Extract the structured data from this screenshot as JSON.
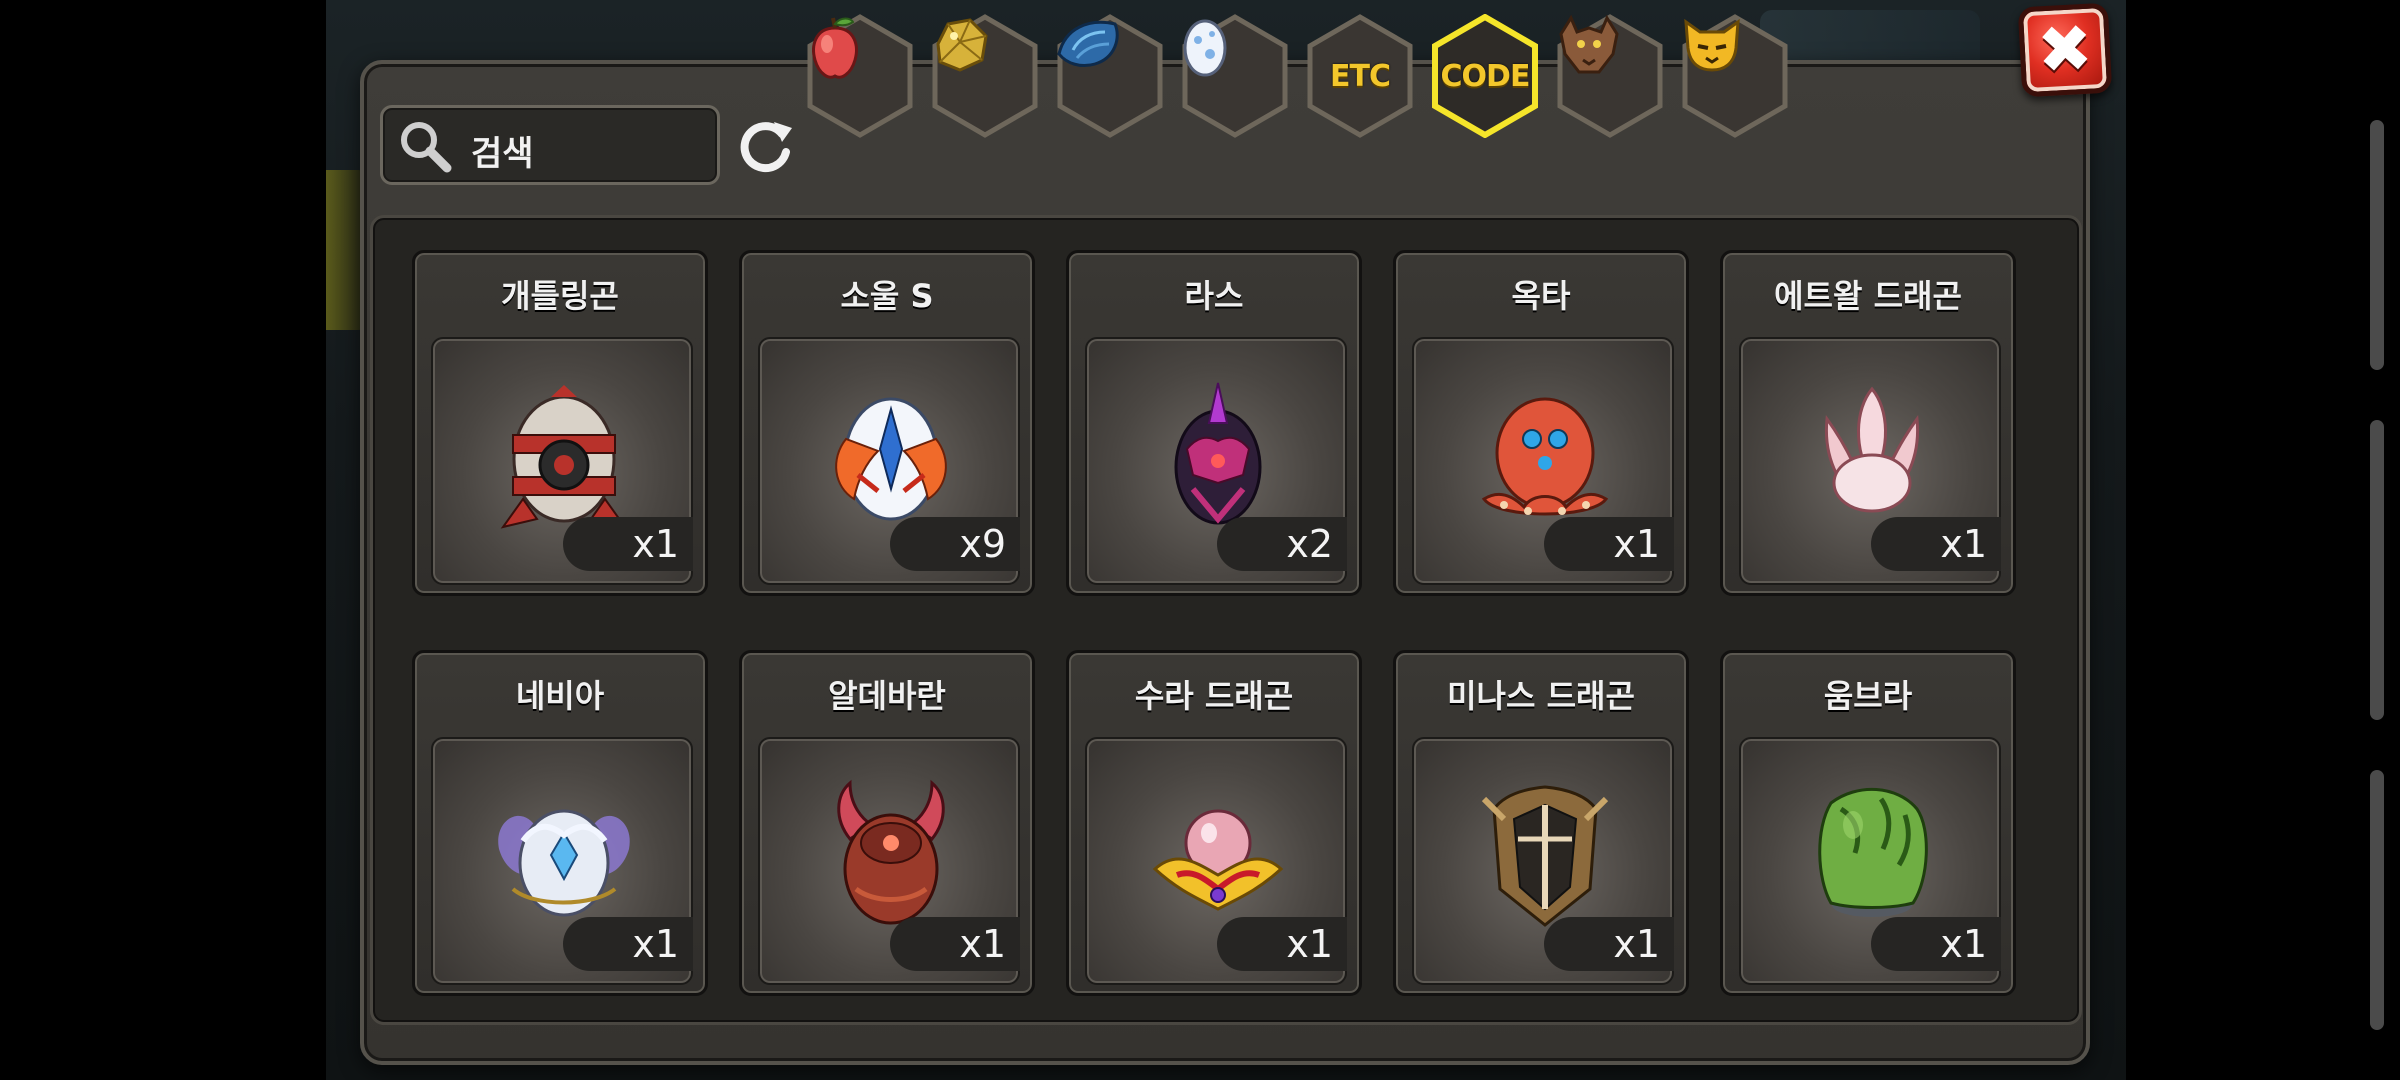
{
  "window": {
    "title": ""
  },
  "close_button": {
    "label": "✖",
    "icon": "close-icon"
  },
  "tabs": [
    {
      "icon": "fruit-icon",
      "label": "",
      "selected": false
    },
    {
      "icon": "gold-nugget-icon",
      "label": "",
      "selected": false
    },
    {
      "icon": "blue-scale-icon",
      "label": "",
      "selected": false
    },
    {
      "icon": "egg-icon",
      "label": "",
      "selected": false
    },
    {
      "icon": "etc-text",
      "label": "ETC",
      "selected": false
    },
    {
      "icon": "code-text",
      "label": "CODE",
      "selected": true
    },
    {
      "icon": "wolf-icon",
      "label": "",
      "selected": false
    },
    {
      "icon": "cat-face-icon",
      "label": "",
      "selected": false
    }
  ],
  "search": {
    "label": "검색",
    "icon": "search-icon"
  },
  "refresh": {
    "icon": "refresh-icon"
  },
  "items": [
    {
      "name": "개틀링곤",
      "qty": "x1",
      "icon": "mech-egg-icon",
      "color": "#b8322b"
    },
    {
      "name": "소울 S",
      "qty": "x9",
      "icon": "winged-egg-icon",
      "color": "#f06a2a"
    },
    {
      "name": "라스",
      "qty": "x2",
      "icon": "dark-horn-egg-icon",
      "color": "#c0307a"
    },
    {
      "name": "옥타",
      "qty": "x1",
      "icon": "octopus-egg-icon",
      "color": "#e0553a"
    },
    {
      "name": "에트왈 드래곤",
      "qty": "x1",
      "icon": "lotus-egg-icon",
      "color": "#f1c9cf"
    },
    {
      "name": "네비아",
      "qty": "x1",
      "icon": "crystal-wing-egg-icon",
      "color": "#e7ecf5"
    },
    {
      "name": "알데바란",
      "qty": "x1",
      "icon": "horned-bull-egg-icon",
      "color": "#9a3a2a"
    },
    {
      "name": "수라 드래곤",
      "qty": "x1",
      "icon": "pearl-gold-egg-icon",
      "color": "#e9a6b4"
    },
    {
      "name": "미나스 드래곤",
      "qty": "x1",
      "icon": "helmet-egg-icon",
      "color": "#8c6a3c"
    },
    {
      "name": "움브라",
      "qty": "x1",
      "icon": "leaf-egg-icon",
      "color": "#6fae43"
    }
  ]
}
